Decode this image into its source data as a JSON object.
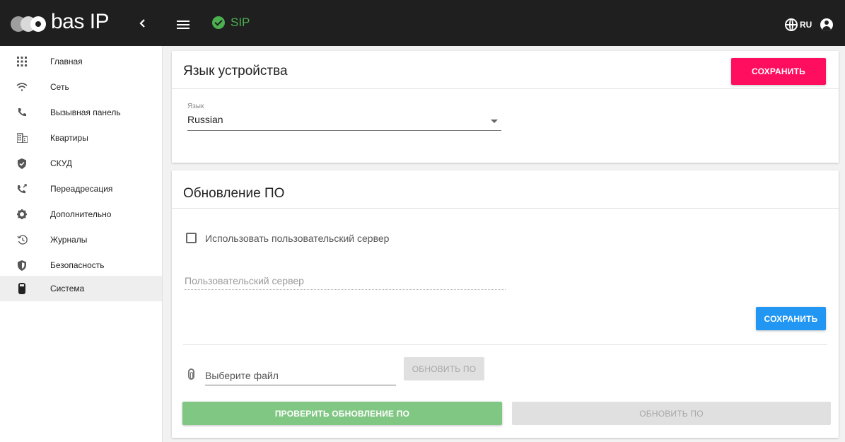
{
  "brand": {
    "logo_text": "bas IP"
  },
  "topbar": {
    "sip_status": "SIP",
    "language_code": "RU",
    "sip_color": "#4caf50"
  },
  "sidebar": {
    "items": [
      {
        "label": "Главная",
        "icon": "grid-icon"
      },
      {
        "label": "Сеть",
        "icon": "wifi-icon"
      },
      {
        "label": "Вызывная панель",
        "icon": "phone-icon"
      },
      {
        "label": "Квартиры",
        "icon": "apartments-icon"
      },
      {
        "label": "СКУД",
        "icon": "shield-check-icon"
      },
      {
        "label": "Переадресация",
        "icon": "call-forward-icon"
      },
      {
        "label": "Дополнительно",
        "icon": "gear-icon"
      },
      {
        "label": "Журналы",
        "icon": "history-icon"
      },
      {
        "label": "Безопасность",
        "icon": "security-icon"
      },
      {
        "label": "Система",
        "icon": "device-icon",
        "active": true
      }
    ]
  },
  "language_card": {
    "title": "Язык устройства",
    "save_label": "СОХРАНИТЬ",
    "field_label": "Язык",
    "selected_value": "Russian"
  },
  "update_card": {
    "title": "Обновление ПО",
    "custom_server_checkbox_label": "Использовать пользовательский сервер",
    "custom_server_checked": false,
    "custom_server_placeholder": "Пользовательский сервер",
    "save_label": "СОХРАНИТЬ",
    "file_placeholder": "Выберите файл",
    "upload_update_label": "ОБНОВИТЬ ПО",
    "check_update_label": "ПРОВЕРИТЬ ОБНОВЛЕНИЕ ПО",
    "update_label": "ОБНОВИТЬ ПО"
  },
  "colors": {
    "accent_pink": "#ff0d5f",
    "accent_blue": "#2196f3",
    "accent_green": "#81c784",
    "topbar_bg": "#1f1f1f"
  }
}
